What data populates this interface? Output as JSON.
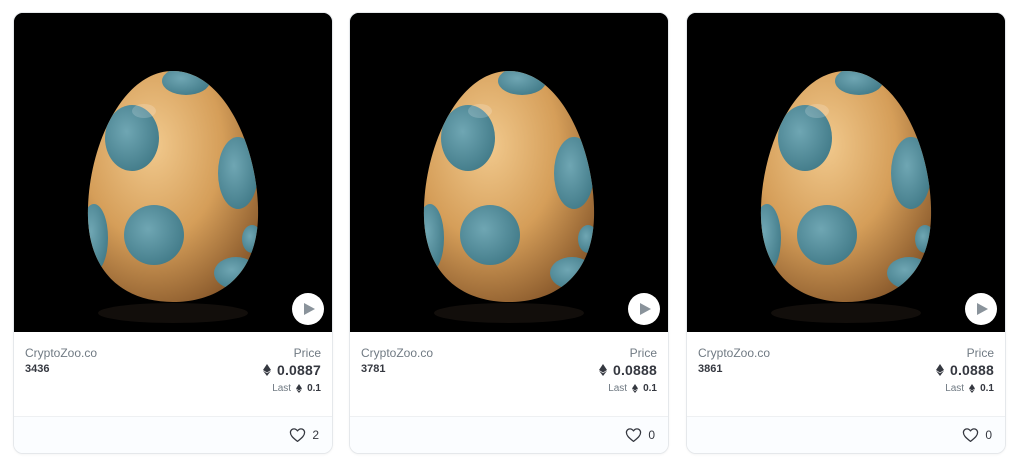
{
  "price_label": "Price",
  "last_label": "Last",
  "icons": {
    "play": "play-icon",
    "eth": "ethereum-icon",
    "favorite": "heart-icon"
  },
  "colors": {
    "media_background": "#000000",
    "egg_shell": "#d8a45f",
    "egg_spots": "#4f8a99",
    "muted_text": "#707a83",
    "strong_text": "#353840"
  },
  "cards": [
    {
      "collection": "CryptoZoo.co",
      "token_id": "3436",
      "price": "0.0887",
      "last": "0.1",
      "favorites": "2"
    },
    {
      "collection": "CryptoZoo.co",
      "token_id": "3781",
      "price": "0.0888",
      "last": "0.1",
      "favorites": "0"
    },
    {
      "collection": "CryptoZoo.co",
      "token_id": "3861",
      "price": "0.0888",
      "last": "0.1",
      "favorites": "0"
    }
  ]
}
